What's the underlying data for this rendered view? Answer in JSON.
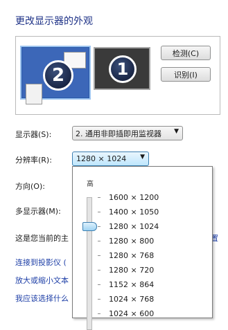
{
  "title": "更改显示器的外观",
  "monitors": {
    "primary_number": "2",
    "secondary_number": "1"
  },
  "buttons": {
    "detect_label": "检测(C)",
    "identify_label": "识别(I)"
  },
  "display": {
    "label": "显示器(S):",
    "value": "2. 通用非即插即用监视器"
  },
  "resolution": {
    "label": "分辨率(R):",
    "value": "1280 × 1024",
    "high_label": "高",
    "options": [
      "1600 × 1200",
      "1400 × 1050",
      "1280 × 1024",
      "1280 × 800",
      "1280 × 768",
      "1280 × 720",
      "1152 × 864",
      "1024 × 768",
      "1024 × 600"
    ]
  },
  "orientation": {
    "label": "方向(O):"
  },
  "multi_display": {
    "label": "多显示器(M):"
  },
  "info_text": "这是您当前的主",
  "links": [
    "连接到投影仪 (",
    "放大或缩小文本",
    "我应该选择什么"
  ],
  "right_link": "置",
  "colors": {
    "title": "#1e3287",
    "link": "#1e3fa7",
    "selected_monitor": "#3c67b8"
  }
}
